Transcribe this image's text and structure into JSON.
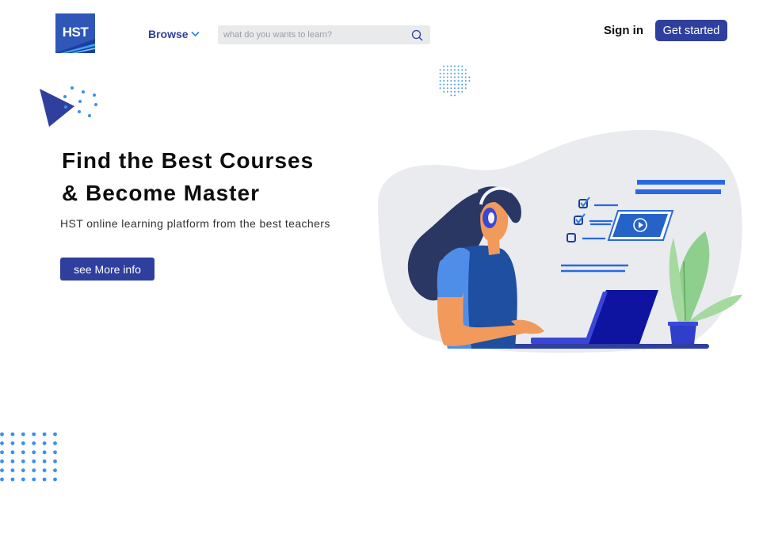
{
  "brand": {
    "logo_text": "HST",
    "color": "#2f3f9e"
  },
  "nav": {
    "browse_label": "Browse"
  },
  "search": {
    "placeholder": "what do you wants to learn?"
  },
  "auth": {
    "signin_label": "Sign in",
    "get_started_label": "Get started"
  },
  "hero": {
    "headline_line1": "Find the Best Courses",
    "headline_line2": "& Become Master",
    "subtitle": "HST online learning platform from the best teachers",
    "cta_label": "see More info"
  }
}
